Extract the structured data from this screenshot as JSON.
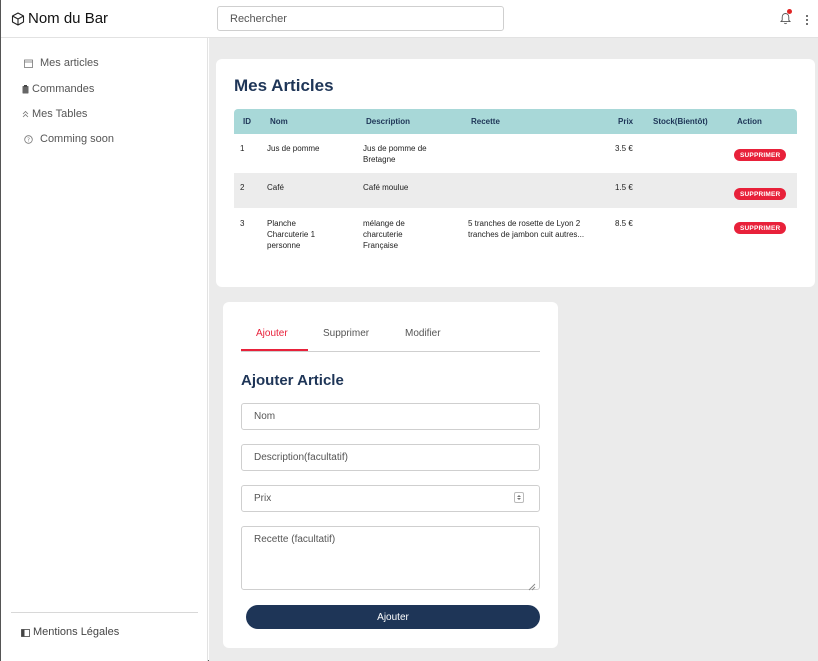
{
  "header": {
    "brand": "Nom du Bar",
    "search_placeholder": "Rechercher"
  },
  "sidebar": {
    "items": [
      {
        "label": "Mes articles",
        "icon": "calendar-icon"
      },
      {
        "label": "Commandes",
        "icon": "clipboard-icon"
      },
      {
        "label": "Mes Tables",
        "icon": "chevrons-up-icon"
      },
      {
        "label": "Comming soon",
        "icon": "help-circle-icon"
      }
    ],
    "legal": "Mentions Légales"
  },
  "articles": {
    "title": "Mes Articles",
    "columns": [
      "ID",
      "Nom",
      "Description",
      "Recette",
      "Prix",
      "Stock(Bientôt)",
      "Action"
    ],
    "rows": [
      {
        "id": "1",
        "nom": "Jus de pomme",
        "description": "Jus de pomme de Bretagne",
        "recette": "",
        "prix": "3.5 €",
        "stock": "",
        "action": "SUPPRIMER"
      },
      {
        "id": "2",
        "nom": "Café",
        "description": "Café moulue",
        "recette": "",
        "prix": "1.5 €",
        "stock": "",
        "action": "SUPPRIMER"
      },
      {
        "id": "3",
        "nom": "Planche Charcuterie 1 personne",
        "description": "mélange de charcuterie Française",
        "recette": "5 tranches de rosette de Lyon 2 tranches de jambon cuit autres...",
        "prix": "8.5 €",
        "stock": "",
        "action": "SUPPRIMER"
      }
    ]
  },
  "form": {
    "tabs": [
      "Ajouter",
      "Supprimer",
      "Modifier"
    ],
    "active_tab": "Ajouter",
    "title": "Ajouter Article",
    "fields": {
      "nom": "Nom",
      "description": "Description(facultatif)",
      "prix": "Prix",
      "recette": "Recette (facultatif)"
    },
    "submit": "Ajouter"
  },
  "colors": {
    "navy": "#1e3557",
    "accent_red": "#e8213a",
    "table_header": "#a8d8d8",
    "main_bg": "#ebebeb"
  }
}
